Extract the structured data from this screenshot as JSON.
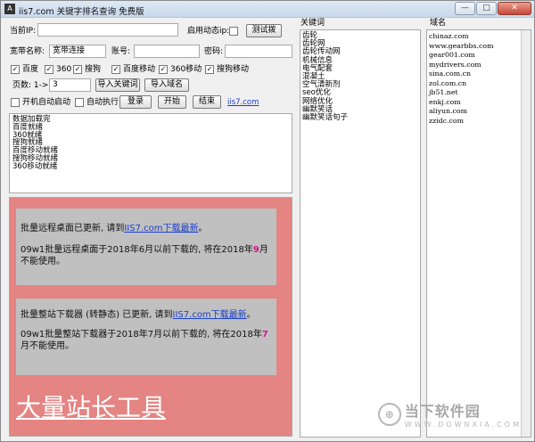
{
  "window": {
    "title": "iis7.com 关键字排名查询 免费版",
    "title_icon": "A",
    "controls": {
      "minimize": "—",
      "maximize": "□",
      "close": "✕"
    }
  },
  "form": {
    "current_ip_label": "当前IP:",
    "current_ip_value": "",
    "enable_dynamic_ip_label": "启用动态ip:",
    "test_button": "测试拨",
    "broadband_name_label": "宽带名称:",
    "broadband_name_value": "宽带连接",
    "account_label": "账号:",
    "account_value": "",
    "password_label": "密码:",
    "password_value": "",
    "engines": [
      {
        "label": "百度",
        "checked": true
      },
      {
        "label": "360",
        "checked": true
      },
      {
        "label": "搜狗",
        "checked": true
      },
      {
        "label": "百度移动",
        "checked": true
      },
      {
        "label": "360移动",
        "checked": true
      },
      {
        "label": "搜狗移动",
        "checked": true
      }
    ],
    "pages_label": "页数: 1->",
    "pages_value": "3",
    "import_keywords_button": "导入关键词",
    "import_domains_button": "导入域名",
    "autostart_label": "开机自动启动",
    "autostart_checked": false,
    "autorun_label": "自动执行",
    "autorun_checked": false,
    "login_button": "登录",
    "start_button": "开始",
    "stop_button": "结束",
    "site_link": "iis7.com"
  },
  "log": [
    "数据加载完",
    "百度就绪",
    "360就绪",
    "搜狗就绪",
    "百度移动就绪",
    "搜狗移动就绪",
    "360移动就绪"
  ],
  "ad": {
    "card1": {
      "line1_prefix": "批量远程桌面已更新, 请到",
      "line1_link": "IIS7.com下载最新",
      "line1_suffix": "。",
      "line2_prefix": "09w1批量远程桌面于2018年6月以前下载的, 将在2018年",
      "line2_highlight": "9",
      "line2_suffix": "月不能使用。"
    },
    "card2": {
      "line1_prefix": "批量整站下载器 (转静态) 已更新, 请到",
      "line1_link": "IIS7.com下载最新",
      "line1_suffix": "。",
      "line2_prefix": "09w1批量整站下载器于2018年7月以前下载的, 将在2018年",
      "line2_highlight": "7",
      "line2_suffix": "月不能使用。"
    },
    "big_title": "大量站长工具"
  },
  "keywords": {
    "header": "关键词",
    "items": [
      "齿轮",
      "齿轮网",
      "齿轮传动网",
      "机械信息",
      "电气配套",
      "混凝土",
      "空气清新剂",
      "seo优化",
      "网络优化",
      "幽默笑话",
      "幽默笑话句子"
    ]
  },
  "domains": {
    "header": "域名",
    "items": [
      "chinaz.com",
      "www.gearbbs.com",
      "gear001.com",
      "mydrivers.com",
      "sina.com.cn",
      "zol.com.cn",
      "jb51.net",
      "enkj.com",
      "aliyun.com",
      "zzidc.com"
    ]
  },
  "watermark": {
    "text": "当下软件园",
    "sub": "WWW.DOWNXIA.COM"
  }
}
